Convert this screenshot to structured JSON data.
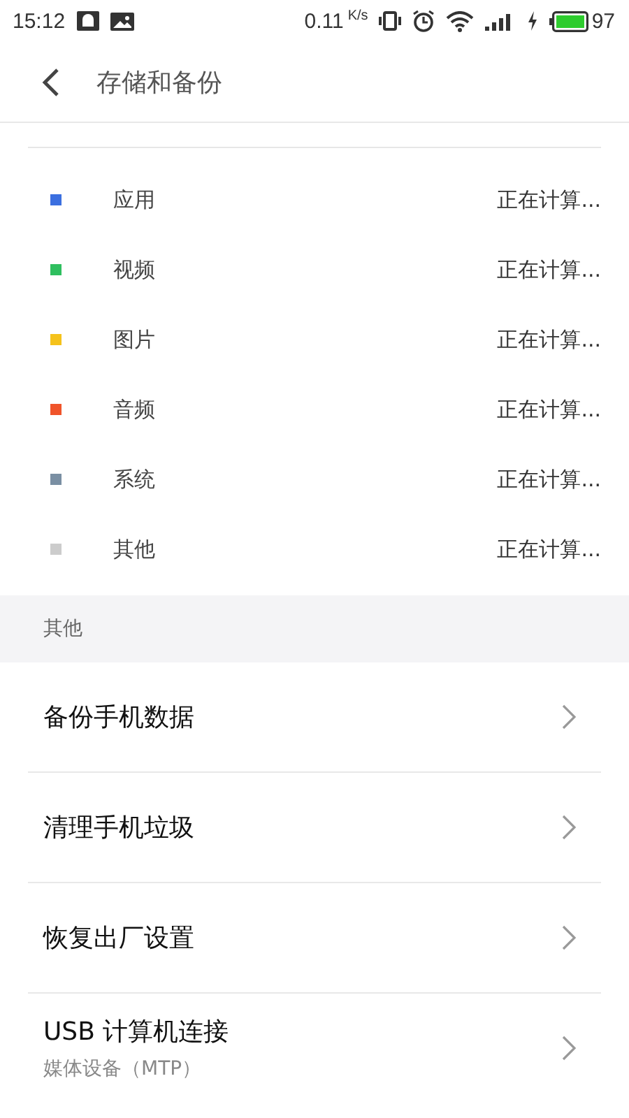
{
  "status_bar": {
    "time": "15:12",
    "speed": "0.11",
    "speed_unit": "K/s",
    "battery": "97"
  },
  "header": {
    "title": "存储和备份"
  },
  "storage_items": [
    {
      "label": "应用",
      "value": "正在计算...",
      "color": "#3b6fe0"
    },
    {
      "label": "视频",
      "value": "正在计算...",
      "color": "#2fbf5f"
    },
    {
      "label": "图片",
      "value": "正在计算...",
      "color": "#f5c21b"
    },
    {
      "label": "音频",
      "value": "正在计算...",
      "color": "#f0542a"
    },
    {
      "label": "系统",
      "value": "正在计算...",
      "color": "#7a8fa3"
    },
    {
      "label": "其他",
      "value": "正在计算...",
      "color": "#cccccc"
    }
  ],
  "section": {
    "title": "其他"
  },
  "menu_items": [
    {
      "title": "备份手机数据"
    },
    {
      "title": "清理手机垃圾"
    },
    {
      "title": "恢复出厂设置"
    },
    {
      "title": "USB 计算机连接",
      "subtitle": "媒体设备（MTP）"
    }
  ]
}
